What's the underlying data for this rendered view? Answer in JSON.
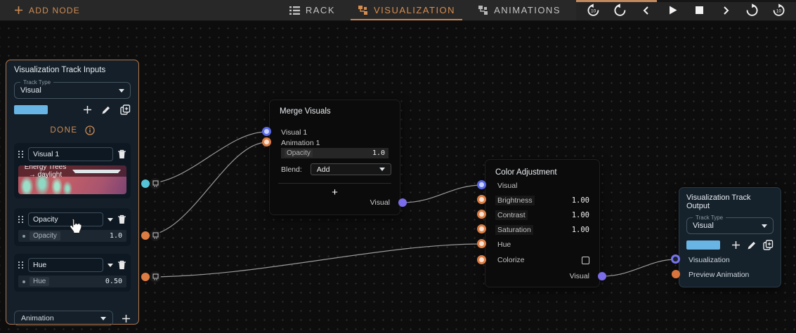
{
  "topbar": {
    "add_node_label": "ADD NODE",
    "tabs": [
      {
        "label": "RACK",
        "active": false
      },
      {
        "label": "VISUALIZATION",
        "active": true
      },
      {
        "label": "ANIMATIONS",
        "active": false
      }
    ],
    "transport_buttons": [
      "replay-10",
      "restart",
      "step-back",
      "play",
      "stop",
      "step-forward",
      "loop",
      "forward-10"
    ]
  },
  "inputs_panel": {
    "title": "Visualization Track Inputs",
    "track_type_label": "Track Type",
    "track_type_value": "Visual",
    "done_label": "DONE",
    "visual_item": {
      "name": "Visual 1",
      "preview_label": "Energy Trees → daylight"
    },
    "opacity_item": {
      "name": "Opacity",
      "param_label": "Opacity",
      "value": "1.0"
    },
    "hue_item": {
      "name": "Hue",
      "param_label": "Hue",
      "value": "0.50"
    },
    "add_dropdown_value": "Animation"
  },
  "merge_node": {
    "title": "Merge Visuals",
    "input1_label": "Visual 1",
    "input2_label": "Animation 1",
    "opacity_label": "Opacity",
    "opacity_value": "1.0",
    "blend_label": "Blend:",
    "blend_value": "Add",
    "add_button_label": "+",
    "output_label": "Visual"
  },
  "color_node": {
    "title": "Color Adjustment",
    "rows": [
      {
        "label": "Visual",
        "value": ""
      },
      {
        "label": "Brightness",
        "value": "1.00"
      },
      {
        "label": "Contrast",
        "value": "1.00"
      },
      {
        "label": "Saturation",
        "value": "1.00"
      },
      {
        "label": "Hue",
        "value": ""
      },
      {
        "label": "Colorize",
        "value": ""
      }
    ],
    "output_label": "Visual"
  },
  "output_panel": {
    "title": "Visualization Track Output",
    "track_type_label": "Track Type",
    "track_type_value": "Visual",
    "input1_label": "Visualization",
    "input2_label": "Preview Animation"
  },
  "colors": {
    "accent_orange": "#cf8c52",
    "port_orange": "#dd7c42",
    "port_cyan": "#53c3d6",
    "port_blue": "#5a68e8",
    "port_purple": "#7a6cea",
    "swatch_blue": "#68b4e4",
    "selected_panel_border": "#b5764a",
    "wire_gray": "#9a9a9a"
  }
}
